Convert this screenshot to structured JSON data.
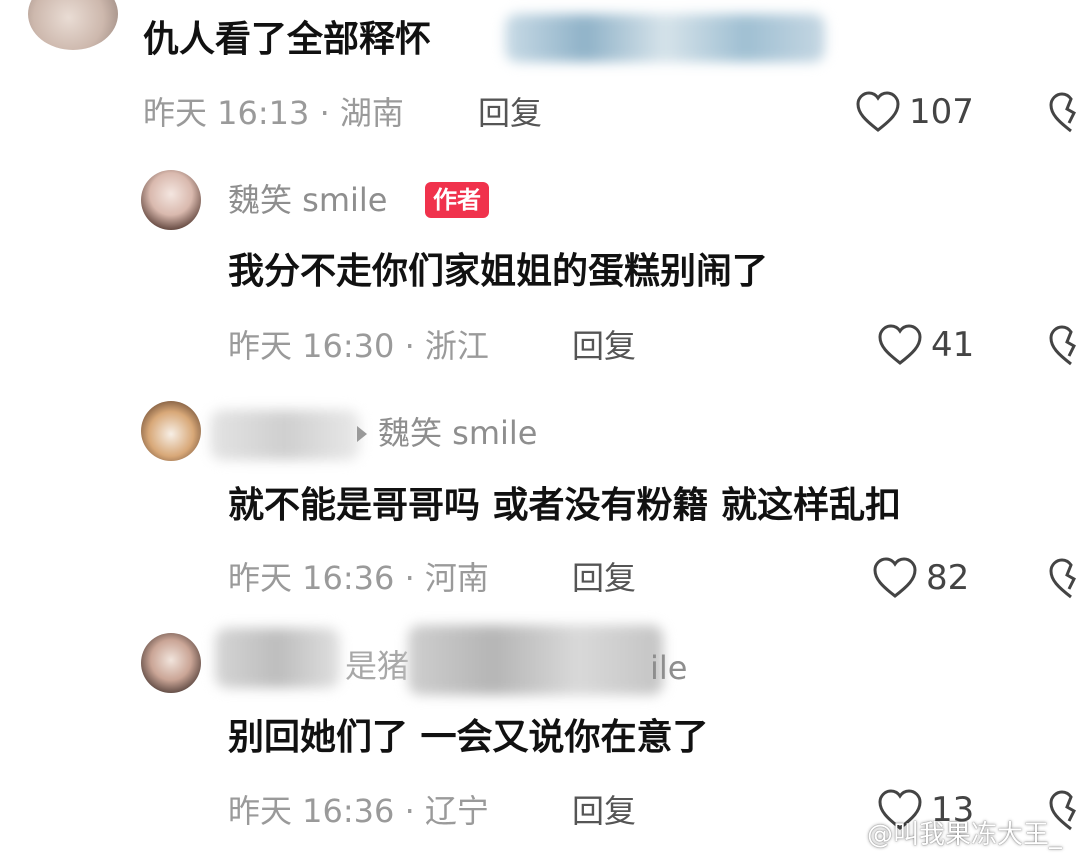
{
  "comments": [
    {
      "text": "仇人看了全部释怀",
      "meta": "昨天 16:13 · 湖南",
      "reply": "回复",
      "likes": "107"
    },
    {
      "username": "魏笑 smile",
      "badge": "作者",
      "text": "我分不走你们家姐姐的蛋糕别闹了",
      "meta": "昨天 16:30 · 浙江",
      "reply": "回复",
      "likes": "41"
    },
    {
      "reply_to": "魏笑 smile",
      "text": "就不能是哥哥吗 或者没有粉籍 就这样乱扣",
      "meta": "昨天 16:36 · 河南",
      "reply": "回复",
      "likes": "82"
    },
    {
      "username_partial": "是猪",
      "username_tail": "ile",
      "text": "别回她们了 一会又说你在意了",
      "meta": "昨天 16:36 · 辽宁",
      "reply": "回复",
      "likes": "13"
    }
  ],
  "watermark": "@叫我果冻大王_",
  "icons": {
    "like": "heart-outline-icon",
    "dislike": "broken-heart-icon",
    "watermark": "weibo-logo-icon"
  },
  "colors": {
    "badge": "#f0324c",
    "meta": "#9a9a9a"
  }
}
